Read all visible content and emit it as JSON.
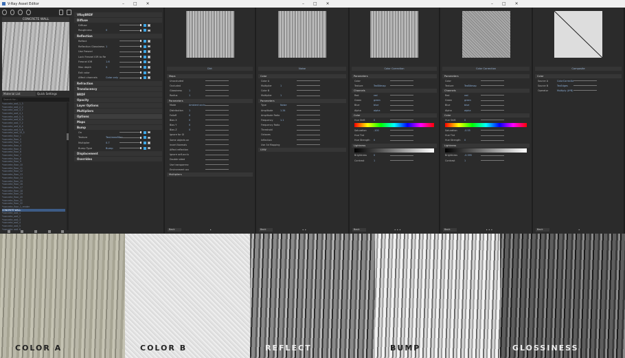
{
  "app": {
    "title": "V-Ray Asset Editor",
    "material_name": "CONCRETE WALL",
    "tabs": [
      "Material List",
      "Quick Settings"
    ],
    "search": "Search for...",
    "materials": [
      "*concrete_wall_1_3",
      "*concrete_wall_2_2",
      "*concrete_wall_3_7",
      "*concrete_wall_4_1",
      "*concrete_wall_5_3",
      "*concrete_wall_6_9",
      "*concrete_wall_7_2",
      "*concrete_wall_8_4",
      "*concrete_wall_9_6",
      "*concrete_wall_10_5",
      "*concrete_floor_1",
      "*concrete_floor_2",
      "*concrete_floor_3",
      "*concrete_floor_4",
      "*concrete_floor_5",
      "*concrete_floor_6",
      "*concrete_floor_7",
      "*concrete_floor_8",
      "*concrete_floor_9",
      "*concrete_floor_10",
      "*concrete_floor_11",
      "*concrete_floor_12",
      "*concrete_floor_13",
      "*concrete_floor_14",
      "*concrete_floor_15",
      "*concrete_floor_16",
      "*concrete_floor_17",
      "*concrete_floor_18",
      "*concrete_floor_19",
      "*concrete_floor_20",
      "*concrete_floor_21",
      "*concrete_floor_22",
      "*concrete_floor_1_render",
      "CONCRETE WALL",
      "*concrete_wall_1",
      "*concrete_wall_2",
      "*concrete_wall_3",
      "*concrete_wall_4",
      "*concrete_wall_5",
      "*concrete_wall_6",
      "*concrete_wall_7",
      "*concrete_wall_8",
      "*concrete_wall_9",
      "*concrete_wall_10",
      "*concrete_wall_11",
      "*concrete_wall_12",
      "*concrete_wall_13",
      "*concrete_wall_14",
      "*concrete_wall_15",
      "*concrete_wall_16",
      "*concrete_wall_17",
      "*concrete_wall_18",
      "*concrete_wall_19"
    ],
    "selected": "CONCRETE WALL"
  },
  "props": {
    "header": "VRayBRDF",
    "sections": [
      {
        "title": "Diffuse",
        "rows": [
          {
            "l": "Diffuse",
            "v": ""
          },
          {
            "l": "Roughness",
            "v": "0"
          }
        ]
      },
      {
        "title": "Reflection",
        "rows": [
          {
            "l": "Reflect",
            "v": ""
          },
          {
            "l": "Reflection Glossiness",
            "v": "1"
          },
          {
            "l": "Use Fresnel",
            "v": ""
          },
          {
            "l": "Lock Fresnel IOR to Refraction IOR",
            "v": ""
          },
          {
            "l": "Fresnel IOR",
            "v": "1.6"
          },
          {
            "l": "Max depth",
            "v": "5"
          },
          {
            "l": "Exit color",
            "v": ""
          },
          {
            "l": "Affect channels",
            "v": "Color only"
          }
        ]
      },
      {
        "title": "Refraction",
        "rows": []
      },
      {
        "title": "Translucency",
        "rows": []
      },
      {
        "title": "BRDF",
        "rows": []
      },
      {
        "title": "Opacity",
        "rows": []
      },
      {
        "title": "Layer Options",
        "rows": []
      },
      {
        "title": "Multipliers",
        "rows": []
      },
      {
        "title": "Options",
        "rows": []
      },
      {
        "title": "Maps",
        "rows": []
      },
      {
        "title": "Bump",
        "rows": [
          {
            "l": "On",
            "v": ""
          },
          {
            "l": "Texture",
            "v": "TexLinearMax"
          },
          {
            "l": "Multiplier",
            "v": "0.7"
          },
          {
            "l": "Bump Type",
            "v": "Bump"
          }
        ]
      },
      {
        "title": "Displacement",
        "rows": []
      },
      {
        "title": "Overrides",
        "rows": []
      }
    ]
  },
  "panels": [
    {
      "name": "Dirt",
      "secs": [
        {
          "t": "Maps",
          "rows": [
            [
              "Unoccluded",
              ""
            ],
            [
              "Occluded",
              ""
            ],
            [
              "Glossiness",
              "1"
            ],
            [
              "Radius",
              "1"
            ]
          ]
        },
        {
          "t": "Parameters",
          "rows": [
            [
              "Mode",
              "Ambient occlusion"
            ],
            [
              "Distribution",
              "1"
            ],
            [
              "Falloff",
              "0"
            ],
            [
              "Bias X",
              "0"
            ],
            [
              "Bias Y",
              "0"
            ],
            [
              "Bias Z",
              "0"
            ],
            [
              "Ignore for GI",
              ""
            ],
            [
              "Same objects only",
              ""
            ],
            [
              "Invert Normals",
              ""
            ],
            [
              "Affect reflection elements",
              ""
            ],
            [
              "Ignore self-occlusion",
              ""
            ],
            [
              "Double sided",
              ""
            ],
            [
              "Use transparency",
              ""
            ],
            [
              "Environment occlusion",
              ""
            ]
          ]
        },
        {
          "t": "Multipliers",
          "rows": []
        }
      ],
      "dots": "•"
    },
    {
      "name": "Noise",
      "secs": [
        {
          "t": "Color",
          "rows": [
            [
              "Color A",
              ""
            ],
            [
              "Multiplier",
              "1"
            ],
            [
              "Color B",
              ""
            ],
            [
              "Multiplier",
              "1"
            ]
          ]
        },
        {
          "t": "Parameters",
          "rows": [
            [
              "Type",
              "Noise"
            ],
            [
              "Amplitude",
              "1.34"
            ],
            [
              "Amplitude Ratio",
              ""
            ],
            [
              "Frequency",
              "1.1"
            ],
            [
              "Frequency Ratio",
              ""
            ],
            [
              "Threshold",
              ""
            ],
            [
              "Octaves",
              ""
            ],
            [
              "Inflection",
              ""
            ],
            [
              "Use 3d Mapping",
              ""
            ]
          ]
        },
        {
          "t": "UVW",
          "rows": []
        }
      ],
      "dots": "• •"
    },
    {
      "name": "Color Correction",
      "secs": [
        {
          "t": "Parameters",
          "rows": [
            [
              "Color",
              ""
            ],
            [
              "Texture",
              "TexBitmap"
            ]
          ]
        },
        {
          "t": "Channels",
          "rows": [
            [
              "Red",
              "red"
            ],
            [
              "Green",
              "green"
            ],
            [
              "Blue",
              "blue"
            ],
            [
              "Alpha",
              "alpha"
            ]
          ]
        },
        {
          "t": "Color",
          "rows": [
            [
              "Hue Shift",
              "0"
            ],
            [
              "Saturation",
              "-100"
            ],
            [
              "Hue Tint",
              ""
            ],
            [
              "Hue Strength",
              "0"
            ]
          ]
        },
        {
          "t": "Lightness",
          "rows": [
            [
              "Brightness",
              "0"
            ],
            [
              "Contrast",
              "1"
            ]
          ]
        }
      ],
      "dots": "• • •"
    },
    {
      "name": "Color Correction",
      "secs": [
        {
          "t": "Parameters",
          "rows": [
            [
              "Color",
              ""
            ],
            [
              "Texture",
              "TexBitmap"
            ]
          ]
        },
        {
          "t": "Channels",
          "rows": [
            [
              "Red",
              "red"
            ],
            [
              "Green",
              "green"
            ],
            [
              "Blue",
              "blue"
            ],
            [
              "Alpha",
              "alpha"
            ]
          ]
        },
        {
          "t": "Color",
          "rows": [
            [
              "Hue Shift",
              "0"
            ],
            [
              "Saturation",
              "-0.55"
            ],
            [
              "Hue Tint",
              ""
            ],
            [
              "Hue Strength",
              "0"
            ]
          ]
        },
        {
          "t": "Lightness",
          "rows": [
            [
              "Brightness",
              "-0.395"
            ],
            [
              "Contrast",
              "1"
            ]
          ]
        }
      ],
      "dots": "• • •"
    },
    {
      "name": "Composite",
      "secs": [
        {
          "t": "Color",
          "rows": [
            [
              "Source A",
              "ColorCorrection"
            ],
            [
              "Source B",
              "TexEdges"
            ],
            [
              "Operator",
              "Multiply (A*B)"
            ]
          ]
        }
      ],
      "dots": "•"
    }
  ],
  "back_label": "Back",
  "bottom": {
    "labels": [
      "COLOR A",
      "COLOR B",
      "REFLECT",
      "BUMP",
      "GLOSSINESS"
    ]
  }
}
